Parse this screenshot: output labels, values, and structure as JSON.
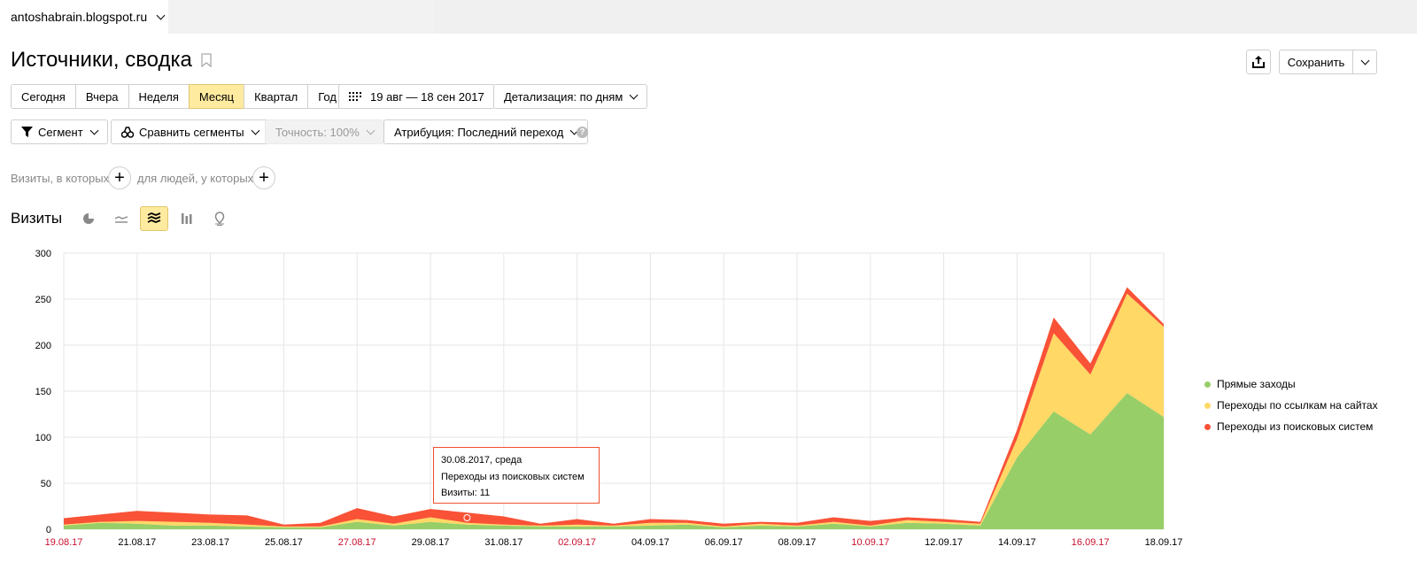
{
  "site": {
    "name": "antoshabrain.blogspot.ru"
  },
  "page": {
    "title": "Источники, сводка"
  },
  "periods": [
    "Сегодня",
    "Вчера",
    "Неделя",
    "Месяц",
    "Квартал",
    "Год"
  ],
  "active_period": "Месяц",
  "date_range": "19 авг — 18 сен 2017",
  "detail": "Детализация: по дням",
  "actions": {
    "save": "Сохранить"
  },
  "filters": {
    "segment": "Сегмент",
    "compare": "Сравнить сегменты",
    "accuracy": "Точность: 100%",
    "attribution": "Атрибуция: Последний переход",
    "help": "?"
  },
  "conditions": {
    "visits_label": "Визиты, в которых",
    "people_label": "для людей, у которых"
  },
  "chart_section": {
    "title": "Визиты"
  },
  "tooltip": {
    "date": "30.08.2017, среда",
    "series": "Переходы из поисковых систем",
    "value": "Визиты: 11"
  },
  "colors": {
    "direct": "#97ce68",
    "links": "#ffd865",
    "search": "#f95236",
    "red_tick": "#c8102e",
    "active": "#ffeba0"
  },
  "chart_data": {
    "type": "area",
    "stacked": true,
    "x": [
      "19.08.17",
      "20.08.17",
      "21.08.17",
      "22.08.17",
      "23.08.17",
      "24.08.17",
      "25.08.17",
      "26.08.17",
      "27.08.17",
      "28.08.17",
      "29.08.17",
      "30.08.17",
      "31.08.17",
      "01.09.17",
      "02.09.17",
      "03.09.17",
      "04.09.17",
      "05.09.17",
      "06.09.17",
      "07.09.17",
      "08.09.17",
      "09.09.17",
      "10.09.17",
      "11.09.17",
      "12.09.17",
      "13.09.17",
      "14.09.17",
      "15.09.17",
      "16.09.17",
      "17.09.17",
      "18.09.17"
    ],
    "xticks": [
      "19.08.17",
      "21.08.17",
      "23.08.17",
      "25.08.17",
      "27.08.17",
      "29.08.17",
      "31.08.17",
      "02.09.17",
      "04.09.17",
      "06.09.17",
      "08.09.17",
      "10.09.17",
      "12.09.17",
      "14.09.17",
      "16.09.17",
      "18.09.17"
    ],
    "red_ticks": [
      "19.08.17",
      "27.08.17",
      "02.09.17",
      "10.09.17",
      "16.09.17"
    ],
    "yticks": [
      0,
      50,
      100,
      150,
      200,
      250,
      300
    ],
    "ylim": [
      0,
      300
    ],
    "grid": true,
    "legend_position": "right",
    "series": [
      {
        "name": "Прямые заходы",
        "color": "#97ce68",
        "values": [
          4,
          7,
          6,
          4,
          4,
          3,
          2,
          2,
          8,
          4,
          8,
          5,
          4,
          3,
          3,
          3,
          4,
          5,
          2,
          4,
          3,
          6,
          3,
          7,
          6,
          4,
          78,
          128,
          103,
          148,
          122
        ]
      },
      {
        "name": "Переходы по ссылкам на сайтах",
        "color": "#ffd865",
        "values": [
          1,
          1,
          3,
          4,
          3,
          2,
          1,
          1,
          3,
          2,
          5,
          2,
          1,
          1,
          2,
          1,
          3,
          2,
          1,
          2,
          1,
          2,
          1,
          3,
          2,
          2,
          20,
          85,
          65,
          108,
          98
        ]
      },
      {
        "name": "Переходы из поисковых систем",
        "color": "#f95236",
        "values": [
          7,
          8,
          11,
          10,
          9,
          10,
          2,
          4,
          12,
          8,
          9,
          11,
          9,
          2,
          6,
          2,
          4,
          3,
          3,
          2,
          3,
          5,
          5,
          3,
          3,
          2,
          10,
          17,
          12,
          7,
          3
        ]
      }
    ]
  }
}
